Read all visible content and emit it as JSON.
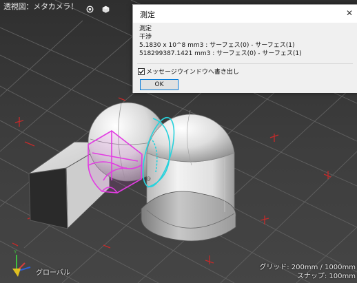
{
  "viewport": {
    "view_label": "透視図：メタカメラ！",
    "coord_label": "グローバル",
    "grid_text": "グリッド: 200mm / 1000mm",
    "snap_text": "スナップ: 100mm"
  },
  "dialog": {
    "title": "測定",
    "close_label": "✕",
    "group_label": "測定",
    "result_label": "干渉",
    "line_scientific": "5.1830 x 10^8 mm3 : サーフェス(0) - サーフェス(1)",
    "line_exact": "518299387.1421 mm3 : サーフェス(0) - サーフェス(1)",
    "checkbox_label": "メッセージウインドウへ書き出し",
    "checkbox_checked": true,
    "ok_label": "OK"
  },
  "colors": {
    "interference": "#e23ce2",
    "highlight": "#28d2dc",
    "grid_axis": "#c62a2a",
    "button_border": "#0078d7"
  }
}
